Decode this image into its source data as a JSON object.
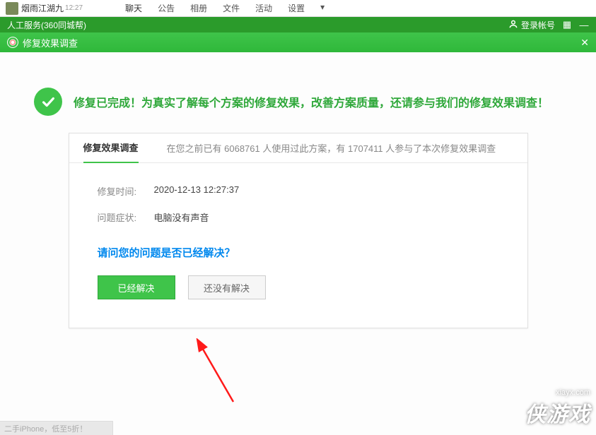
{
  "topTabs": {
    "groupName": "烟雨江湖九",
    "time": "12:27",
    "items": [
      "聊天",
      "公告",
      "相册",
      "文件",
      "活动",
      "设置"
    ]
  },
  "serviceBar": {
    "label": "人工服务(360同城帮)",
    "login": "登录帐号"
  },
  "titleBar": {
    "title": "修复效果调查"
  },
  "headline": "修复已完成！为真实了解每个方案的修复效果，改善方案质量，还请参与我们的修复效果调查！",
  "survey": {
    "tabLabel": "修复效果调查",
    "statsPrefix": "在您之前已有 ",
    "usedCount": "6068761",
    "statsMid": " 人使用过此方案，有 ",
    "joinedCount": "1707411",
    "statsSuffix": " 人参与了本次修复效果调查",
    "timeLabel": "修复时间:",
    "timeValue": "2020-12-13 12:27:37",
    "symptomLabel": "问题症状:",
    "symptomValue": "电脑没有声音",
    "question": "请问您的问题是否已经解决？",
    "solvedBtn": "已经解决",
    "notSolvedBtn": "还没有解决"
  },
  "watermark": {
    "cn": "侠游戏",
    "en": "xiayx.com"
  },
  "bottomStrip": "二手iPhone，低至5折！"
}
